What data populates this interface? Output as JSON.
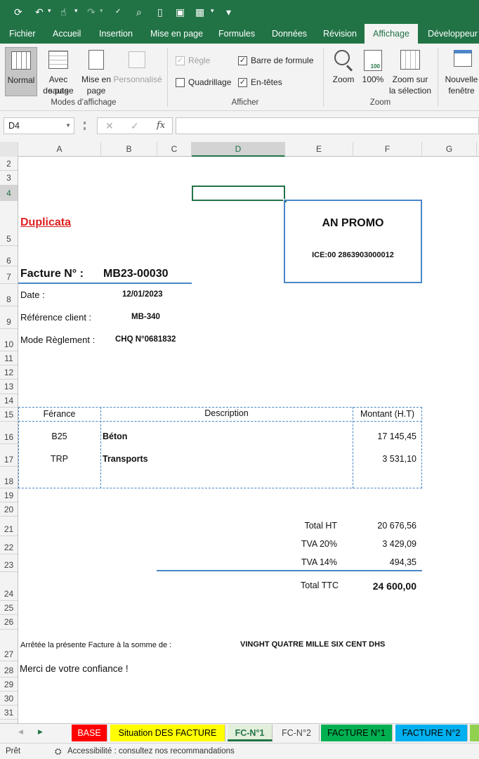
{
  "ribbon_tabs": [
    "Fichier",
    "Accueil",
    "Insertion",
    "Mise en page",
    "Formules",
    "Données",
    "Révision",
    "Affichage",
    "Développeur"
  ],
  "ribbon": {
    "normal_label": "Normal",
    "page_breaks_label_1": "Avec sauts",
    "page_breaks_label_2": "de page",
    "page_layout_label_1": "Mise en",
    "page_layout_label_2": "page",
    "custom_label": "Personnalisé",
    "group_views": "Modes d’affichage",
    "ruler_label": "Règle",
    "formula_bar_label": "Barre de formule",
    "gridlines_label": "Quadrillage",
    "headings_label": "En-têtes",
    "group_show": "Afficher",
    "zoom_label": "Zoom",
    "zoom100_label": "100%",
    "zoom100_icon_text": "100",
    "zoom_selection_label_1": "Zoom sur",
    "zoom_selection_label_2": "la sélection",
    "group_zoom": "Zoom",
    "new_window_label_1": "Nouvelle",
    "new_window_label_2": "fenêtre"
  },
  "formula_bar": {
    "name_box": "D4",
    "fx": "fx",
    "value": ""
  },
  "columns": [
    "A",
    "B",
    "C",
    "D",
    "E",
    "F",
    "G"
  ],
  "rows": [
    "2",
    "3",
    "4",
    "5",
    "6",
    "7",
    "8",
    "9",
    "10",
    "11",
    "12",
    "13",
    "14",
    "15",
    "16",
    "17",
    "18",
    "19",
    "20",
    "21",
    "22",
    "23",
    "24",
    "25",
    "26",
    "27",
    "28",
    "29",
    "30",
    "31"
  ],
  "invoice": {
    "duplicata": "Duplicata",
    "company": "AN PROMO",
    "ice": "ICE:00 2863903000012",
    "facture_label": "Facture N° :",
    "facture_no": "MB23-00030",
    "date_label": "Date :",
    "date_value": "12/01/2023",
    "ref_label": "Référence client :",
    "ref_value": "MB-340",
    "mode_label": "Mode Règlement :",
    "mode_value": "CHQ N°0681832",
    "table_headers": [
      "Férance",
      "Description",
      "Montant (H.T)"
    ],
    "items": [
      {
        "ref": "B25",
        "desc": "Béton",
        "amount": "17 145,45"
      },
      {
        "ref": "TRP",
        "desc": "Transports",
        "amount": "3 531,10"
      }
    ],
    "totals": [
      {
        "label": "Total HT",
        "value": "20 676,56"
      },
      {
        "label": "TVA 20%",
        "value": "3 429,09"
      },
      {
        "label": "TVA 14%",
        "value": "494,35"
      }
    ],
    "ttc_label": "Total TTC",
    "ttc_value": "24 600,00",
    "arrete_label": "Arrêtée la présente Facture à la somme de :",
    "arrete_value": "VINGHT QUATRE MILLE SIX CENT DHS",
    "merci": "Merci de votre confiance !"
  },
  "sheet_tabs": [
    {
      "label": "BASE",
      "bg": "#ff0000",
      "color": "#ffffff"
    },
    {
      "label": "Situation DES FACTURE",
      "bg": "#ffff00",
      "color": "#000000"
    },
    {
      "label": "FC-N°1",
      "bg": "#e2efda",
      "color": "#217346",
      "active": true
    },
    {
      "label": "FC-N°2",
      "bg": "#f3f3f3",
      "color": "#444444"
    },
    {
      "label": "FACTURE N°1",
      "bg": "#00b050",
      "color": "#000000"
    },
    {
      "label": "FACTURE N°2",
      "bg": "#00b0f0",
      "color": "#000000"
    }
  ],
  "status": {
    "ready": "Prêt",
    "accessibility": "Accessibilité : consultez nos recommandations"
  },
  "colors": {
    "excel_green": "#217346",
    "box_blue": "#4a86c8",
    "duplicata_red": "#e02020"
  }
}
